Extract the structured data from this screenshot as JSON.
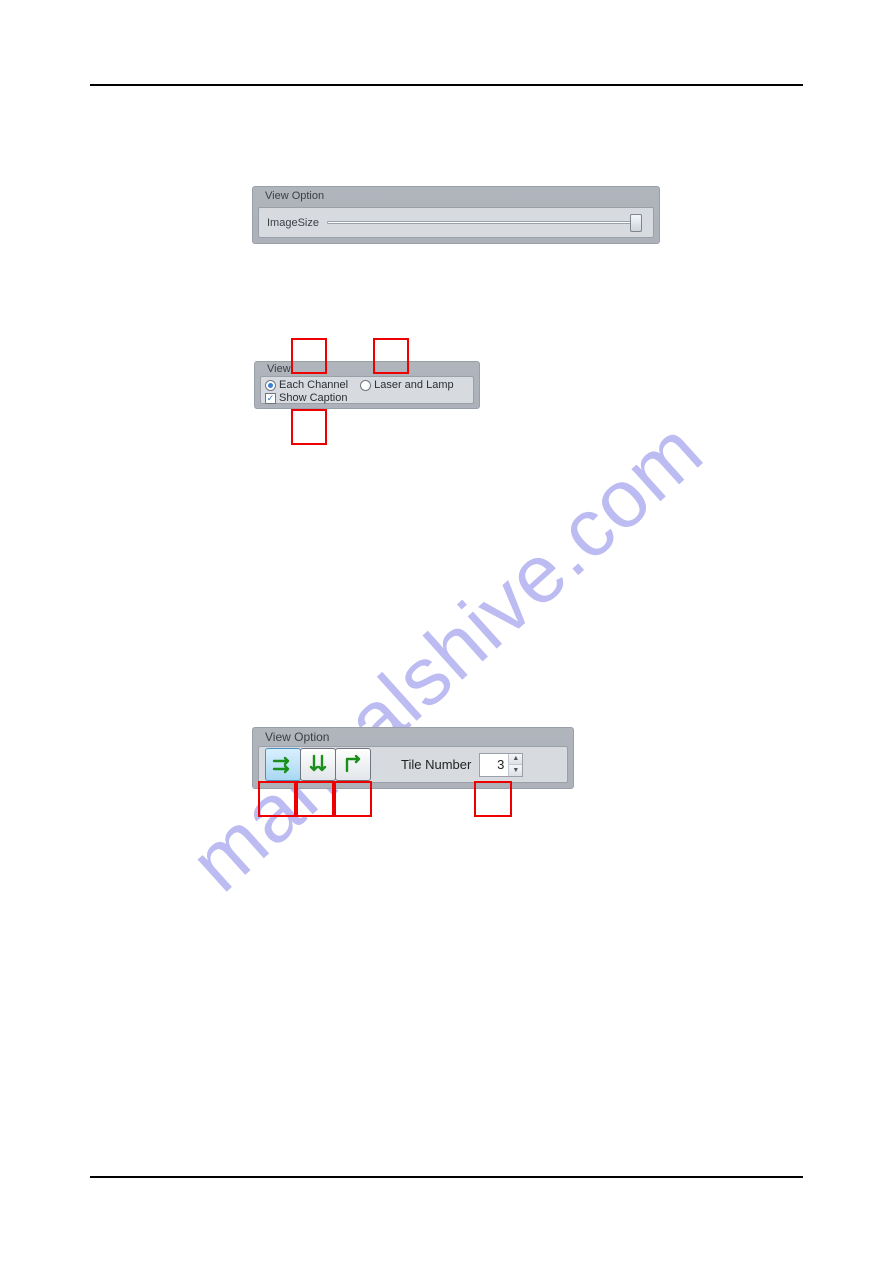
{
  "watermark": "manualshive.com",
  "panel1": {
    "title": "View Option",
    "slider_label": "ImageSize"
  },
  "panel2": {
    "title": "View",
    "radio_each_channel": "Each Channel",
    "radio_laser_lamp": "Laser and Lamp",
    "checkbox_show_caption": "Show Caption"
  },
  "panel3": {
    "title": "View Option",
    "tile_label": "Tile Number",
    "tile_value": "3"
  }
}
